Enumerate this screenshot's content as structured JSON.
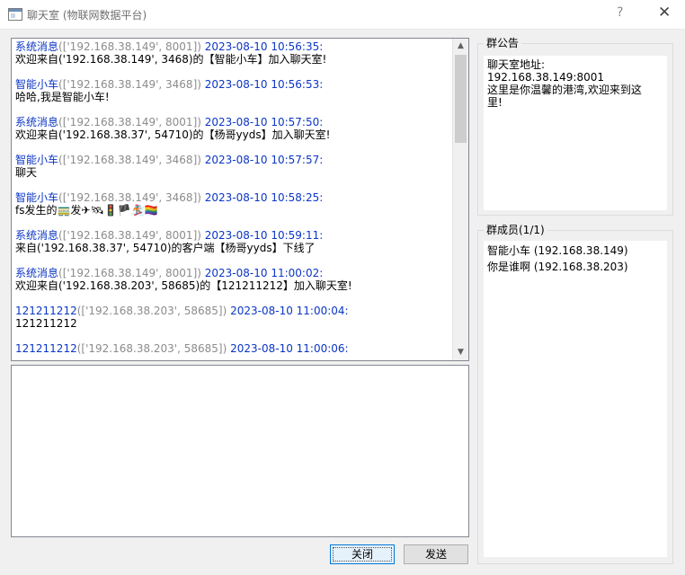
{
  "window": {
    "title": "聊天室 (物联网数据平台)",
    "help_glyph": "?",
    "close_glyph": "✕"
  },
  "chat": {
    "messages": [
      {
        "sender": "系统消息",
        "address": "(['192.168.38.149', 8001])",
        "timestamp": "2023-08-10 10:56:35:",
        "body": "欢迎来自('192.168.38.149', 3468)的【智能小车】加入聊天室!"
      },
      {
        "sender": "智能小车",
        "address": "(['192.168.38.149', 3468])",
        "timestamp": "2023-08-10 10:56:53:",
        "body": "哈哈,我是智能小车!"
      },
      {
        "sender": "系统消息",
        "address": "(['192.168.38.149', 8001])",
        "timestamp": "2023-08-10 10:57:50:",
        "body": "欢迎来自('192.168.38.37', 54710)的【杨哥yyds】加入聊天室!"
      },
      {
        "sender": "智能小车",
        "address": "(['192.168.38.149', 3468])",
        "timestamp": "2023-08-10 10:57:57:",
        "body": "聊天"
      },
      {
        "sender": "智能小车",
        "address": "(['192.168.38.149', 3468])",
        "timestamp": "2023-08-10 10:58:25:",
        "body": "fs发生的🚃发✈🛰🚦🏴🏂🏳️‍🌈"
      },
      {
        "sender": "系统消息",
        "address": "(['192.168.38.149', 8001])",
        "timestamp": "2023-08-10 10:59:11:",
        "body": "来自('192.168.38.37', 54710)的客户端【杨哥yyds】下线了"
      },
      {
        "sender": "系统消息",
        "address": "(['192.168.38.149', 8001])",
        "timestamp": "2023-08-10 11:00:02:",
        "body": "欢迎来自('192.168.38.203', 58685)的【121211212】加入聊天室!"
      },
      {
        "sender": "121211212",
        "address": "(['192.168.38.203', 58685])",
        "timestamp": "2023-08-10 11:00:04:",
        "body": "121211212"
      },
      {
        "sender": "121211212",
        "address": "(['192.168.38.203', 58685])",
        "timestamp": "2023-08-10 11:00:06:",
        "body": ""
      }
    ],
    "input_value": ""
  },
  "buttons": {
    "close_label": "关闭",
    "send_label": "发送"
  },
  "notice": {
    "title": "群公告",
    "lines": [
      "聊天室地址: 192.168.38.149:8001",
      "这里是你温馨的港湾,欢迎来到这",
      "里!"
    ]
  },
  "members": {
    "title": "群成员(1/1)",
    "items": [
      "智能小车 (192.168.38.149)",
      "你是谁啊 (192.168.38.203)"
    ]
  },
  "colors": {
    "sender": "#0b36c5",
    "timestamp": "#0b36c5",
    "address": "#8c8c8c",
    "focus_border": "#0078d7"
  }
}
